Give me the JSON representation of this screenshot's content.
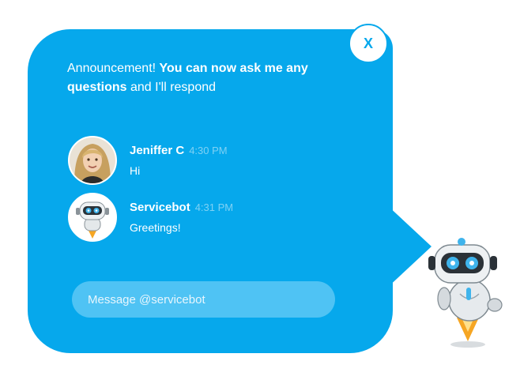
{
  "announcement": {
    "prefix": "Announcement! ",
    "bold": "You can now ask me any questions",
    "suffix": " and I'll respond"
  },
  "close": {
    "label": "X"
  },
  "messages": [
    {
      "name": "Jeniffer C",
      "time": "4:30 PM",
      "text": "Hi"
    },
    {
      "name": "Servicebot",
      "time": "4:31 PM",
      "text": "Greetings!"
    }
  ],
  "input": {
    "placeholder": "Message @servicebot"
  },
  "colors": {
    "bubble": "#06a8ec",
    "input": "#4fc3f4",
    "time": "#7fd1f4"
  }
}
